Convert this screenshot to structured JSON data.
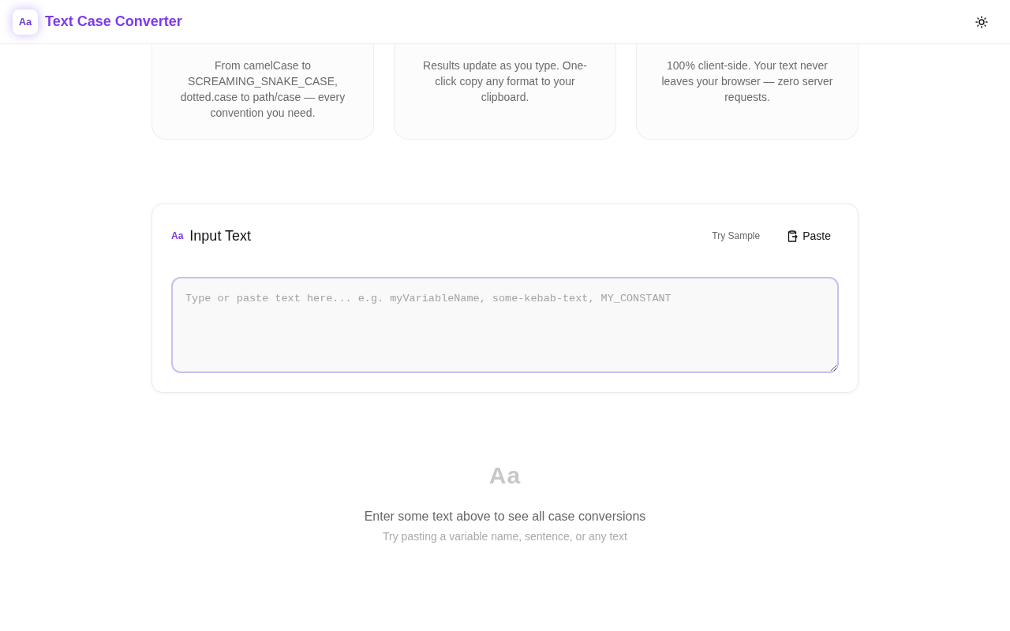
{
  "header": {
    "logo": "Aa",
    "title": "Text Case Converter"
  },
  "features": [
    {
      "description": "From camelCase to SCREAMING_SNAKE_CASE, dotted.case to path/case — every convention you need."
    },
    {
      "description": "Results update as you type. One-click copy any format to your clipboard."
    },
    {
      "description": "100% client-side. Your text never leaves your browser — zero server requests."
    }
  ],
  "input_card": {
    "icon": "Aa",
    "title": "Input Text",
    "sample_button": "Try Sample",
    "paste_button": "Paste",
    "placeholder": "Type or paste text here... e.g. myVariableName, some-kebab-text, MY_CONSTANT"
  },
  "empty_state": {
    "icon": "Aa",
    "message": "Enter some text above to see all case conversions",
    "hint": "Try pasting a variable name, sentence, or any text"
  }
}
